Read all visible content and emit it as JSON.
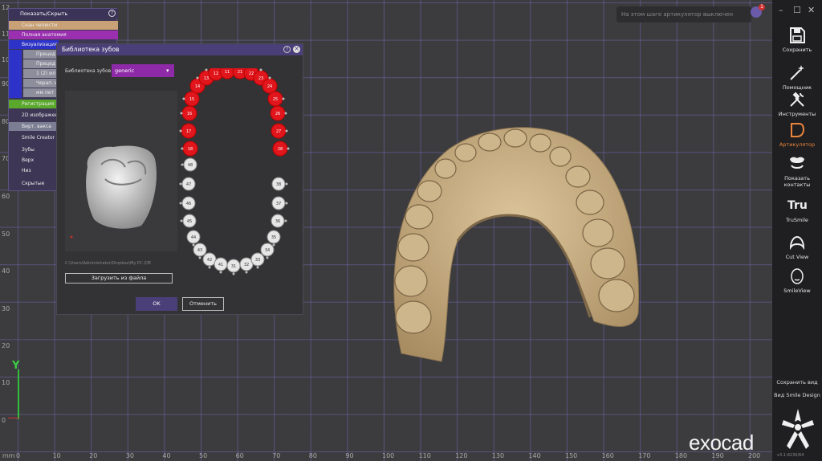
{
  "app": {
    "brand": "exocad"
  },
  "viewport": {
    "y_ticks": [
      "12",
      "11",
      "10",
      "90",
      "80",
      "70",
      "60",
      "50",
      "40",
      "30",
      "20",
      "10",
      "0"
    ],
    "x_ticks": [
      "0",
      "10",
      "20",
      "30",
      "40",
      "50",
      "60",
      "70",
      "80",
      "90",
      "100",
      "110",
      "120",
      "130",
      "140",
      "150",
      "160",
      "170",
      "180",
      "190",
      "200"
    ],
    "axis_y_label": "Y",
    "unit_label": "mm"
  },
  "notification": {
    "text": "На этом шаге артикулятор выключен",
    "badge": "1"
  },
  "window_controls": {
    "minimize": "–",
    "maximize": "☐",
    "close": "✕"
  },
  "left_panel": {
    "header": "Показать/Скрыть",
    "help": "?",
    "rows": [
      {
        "label": "Скан челюсти",
        "color": "#c8a176"
      },
      {
        "label": "Полная анатомия",
        "color": "#9a2fb0"
      },
      {
        "label": "Визуализация",
        "color": "#2d33c8"
      },
      {
        "label": "Прецед",
        "color": "#8d8e9c"
      },
      {
        "label": "Прецед",
        "color": "#8d8e9c"
      },
      {
        "label": "1 (2) ил",
        "color": "#8d8e9c"
      },
      {
        "label": "Черап. ю",
        "color": "#8d8e9c"
      },
      {
        "label": "мм пет",
        "color": "#8d8e9c"
      },
      {
        "label": "Регистрация",
        "color": "#5aa82c"
      },
      {
        "label": "2D изображения",
        "color": "#3d3755"
      },
      {
        "label": "Вирт. вакса",
        "color": "#7b7d92"
      },
      {
        "label": "Smile Creator",
        "color": "#3d3755"
      },
      {
        "label": "Зубы",
        "color": "#3d3755"
      },
      {
        "label": "Верх",
        "color": "#3d3755"
      },
      {
        "label": "Низ",
        "color": "#3d3755"
      },
      {
        "label": "Скрытые",
        "color": "#3d3755"
      }
    ]
  },
  "dialog": {
    "title": "Библиотека зубов",
    "help": "?",
    "close": "✕",
    "library_label": "Библиотека зубов",
    "library_value": "generic",
    "file_path": "C:\\Users\\Administrator\\Dropbox\\My PC (DE",
    "load_button": "Загрузить из файла",
    "ok_button": "OK",
    "cancel_button": "Отменить",
    "upper_teeth": [
      "18",
      "17",
      "16",
      "15",
      "14",
      "13",
      "12",
      "11",
      "21",
      "22",
      "23",
      "24",
      "25",
      "26",
      "27",
      "28"
    ],
    "lower_teeth": [
      "48",
      "47",
      "46",
      "45",
      "44",
      "43",
      "42",
      "41",
      "31",
      "32",
      "33",
      "34",
      "35",
      "36",
      "37",
      "38"
    ],
    "selected_color": "#e0161c"
  },
  "toolbar": {
    "items": [
      {
        "label": "Сохранить",
        "icon": "save-icon"
      },
      {
        "label": "Помощник",
        "icon": "wand-icon"
      },
      {
        "label": "Инструменты",
        "icon": "tools-icon"
      },
      {
        "label": "Артикулятор",
        "icon": "articulator-icon",
        "active": true
      },
      {
        "label": "Показать контакты",
        "icon": "contacts-icon"
      },
      {
        "label": "TruSmile",
        "icon": "trusmile-icon"
      },
      {
        "label": "Cut View",
        "icon": "cut-view-icon"
      },
      {
        "label": "SmileView",
        "icon": "smileview-icon"
      }
    ],
    "save_view": "Сохранить вид",
    "smile_design_view": "Вид Smile Design",
    "version": "v3.1-8230/64"
  }
}
